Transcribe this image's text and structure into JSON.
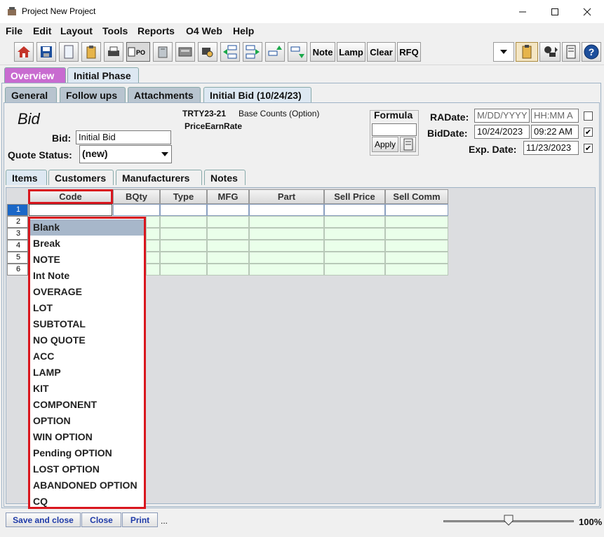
{
  "window": {
    "title": "Project New Project"
  },
  "menu": [
    "File",
    "Edit",
    "Layout",
    "Tools",
    "Reports",
    "O4 Web",
    "Help"
  ],
  "toolbar": {
    "icons": [
      "house-icon",
      "save-icon",
      "document-icon",
      "clipboard-icon",
      "print-icon",
      "purchase-order-icon",
      "filter-icon",
      "calculator-icon",
      "lookup-icon",
      "move-left-icon",
      "move-right-icon",
      "move-up-icon",
      "move-down-icon"
    ],
    "text_buttons": [
      "Note",
      "Lamp",
      "Clear",
      "RFQ"
    ]
  },
  "phase_tabs": [
    "Overview",
    "Initial Phase"
  ],
  "sub_tabs": [
    "General",
    "Follow ups",
    "Attachments",
    "Initial Bid (10/24/23)"
  ],
  "bid": {
    "heading": "Bid",
    "bid_label": "Bid:",
    "bid_value": "Initial Bid",
    "quote_status_label": "Quote Status:",
    "quote_status_value": "(new)",
    "project_code": "TRTY23-21",
    "base_counts": "Base Counts (Option)",
    "price_earn_rate": "PriceEarnRate",
    "formula_label": "Formula",
    "apply_label": "Apply",
    "radate_label": "RADate:",
    "radate_placeholder": "M/DD/YYYY",
    "radate_time_placeholder": "HH:MM A",
    "biddate_label": "BidDate:",
    "biddate_value": "10/24/2023",
    "biddate_time": "09:22 AM",
    "expdate_label": "Exp. Date:",
    "expdate_value": "11/23/2023",
    "checkbox_states": [
      false,
      true,
      true
    ]
  },
  "item_tabs": [
    "Items",
    "Customers",
    "Manufacturers",
    "Notes"
  ],
  "grid": {
    "columns": [
      "Code",
      "BQty",
      "Type",
      "MFG",
      "Part",
      "Sell Price",
      "Sell Comm"
    ],
    "rows": [
      "1",
      "2",
      "3",
      "4",
      "5",
      "6"
    ]
  },
  "code_dropdown": {
    "selected": "Blank",
    "options": [
      "Blank",
      "Break",
      "NOTE",
      "Int Note",
      "OVERAGE",
      "LOT",
      "SUBTOTAL",
      "NO QUOTE",
      "ACC",
      "LAMP",
      "KIT",
      "COMPONENT",
      "OPTION",
      "WIN OPTION",
      "Pending OPTION",
      "LOST OPTION",
      "ABANDONED OPTION",
      "CQ"
    ]
  },
  "bottom": {
    "buttons": [
      "Save and close",
      "Close",
      "Print"
    ],
    "ellipsis": "...",
    "zoom": "100%",
    "zoom_level": 0.5
  },
  "colors": {
    "highlight": "#d9161e",
    "overview_tab": "#c86bd0",
    "row_selected": "#1b67c7",
    "grid_cell": "#eaffea"
  }
}
